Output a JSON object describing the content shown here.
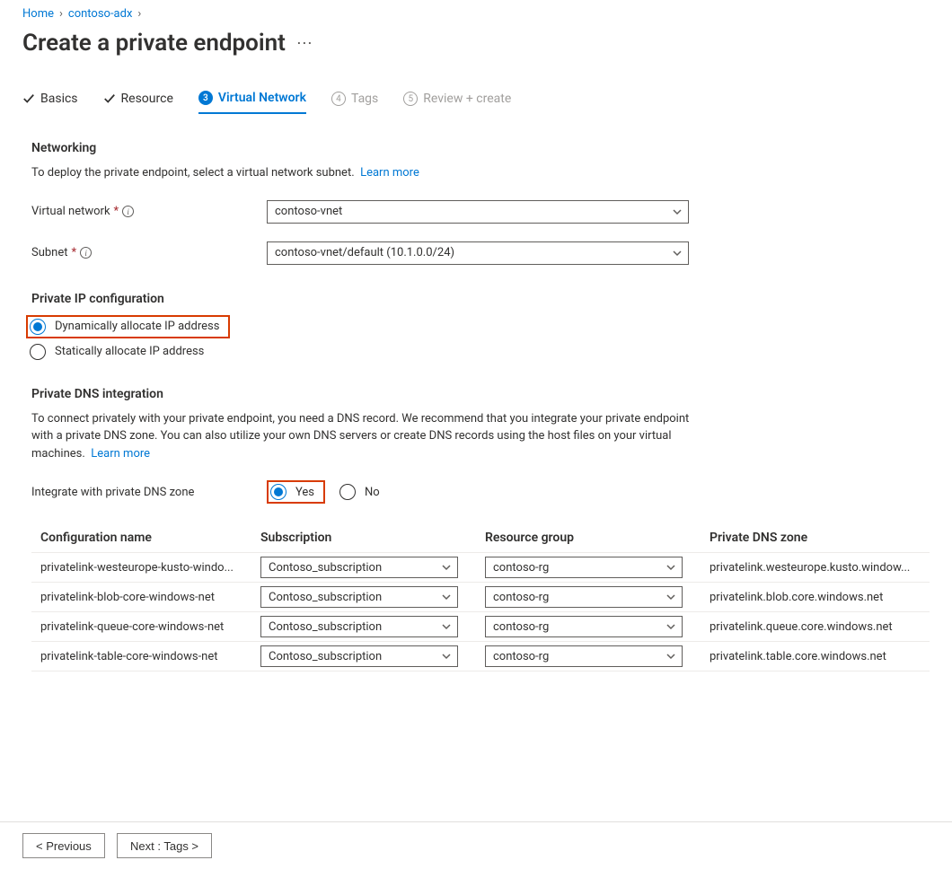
{
  "breadcrumb": {
    "home": "Home",
    "cluster": "contoso-adx"
  },
  "page_title": "Create a private endpoint",
  "tabs": {
    "basics": "Basics",
    "resource": "Resource",
    "virtual_network": "Virtual Network",
    "tags_num": "4",
    "tags": "Tags",
    "review_num": "5",
    "review": "Review + create"
  },
  "networking": {
    "heading": "Networking",
    "desc": "To deploy the private endpoint, select a virtual network subnet.",
    "learn_more": "Learn more",
    "vnet_label": "Virtual network",
    "vnet_value": "contoso-vnet",
    "subnet_label": "Subnet",
    "subnet_value": "contoso-vnet/default (10.1.0.0/24)"
  },
  "ipconfig": {
    "heading": "Private IP configuration",
    "dynamic": "Dynamically allocate IP address",
    "static": "Statically allocate IP address"
  },
  "dns": {
    "heading": "Private DNS integration",
    "desc": "To connect privately with your private endpoint, you need a DNS record. We recommend that you integrate your private endpoint with a private DNS zone. You can also utilize your own DNS servers or create DNS records using the host files on your virtual machines.",
    "learn_more": "Learn more",
    "integrate_label": "Integrate with private DNS zone",
    "yes": "Yes",
    "no": "No",
    "headers": {
      "config": "Configuration name",
      "subscription": "Subscription",
      "rg": "Resource group",
      "zone": "Private DNS zone"
    },
    "rows": [
      {
        "name": "privatelink-westeurope-kusto-windo...",
        "sub": "Contoso_subscription",
        "rg": "contoso-rg",
        "zone": "privatelink.westeurope.kusto.window..."
      },
      {
        "name": "privatelink-blob-core-windows-net",
        "sub": "Contoso_subscription",
        "rg": "contoso-rg",
        "zone": "privatelink.blob.core.windows.net"
      },
      {
        "name": "privatelink-queue-core-windows-net",
        "sub": "Contoso_subscription",
        "rg": "contoso-rg",
        "zone": "privatelink.queue.core.windows.net"
      },
      {
        "name": "privatelink-table-core-windows-net",
        "sub": "Contoso_subscription",
        "rg": "contoso-rg",
        "zone": "privatelink.table.core.windows.net"
      }
    ]
  },
  "footer": {
    "prev": "<  Previous",
    "next": "Next : Tags  >"
  }
}
